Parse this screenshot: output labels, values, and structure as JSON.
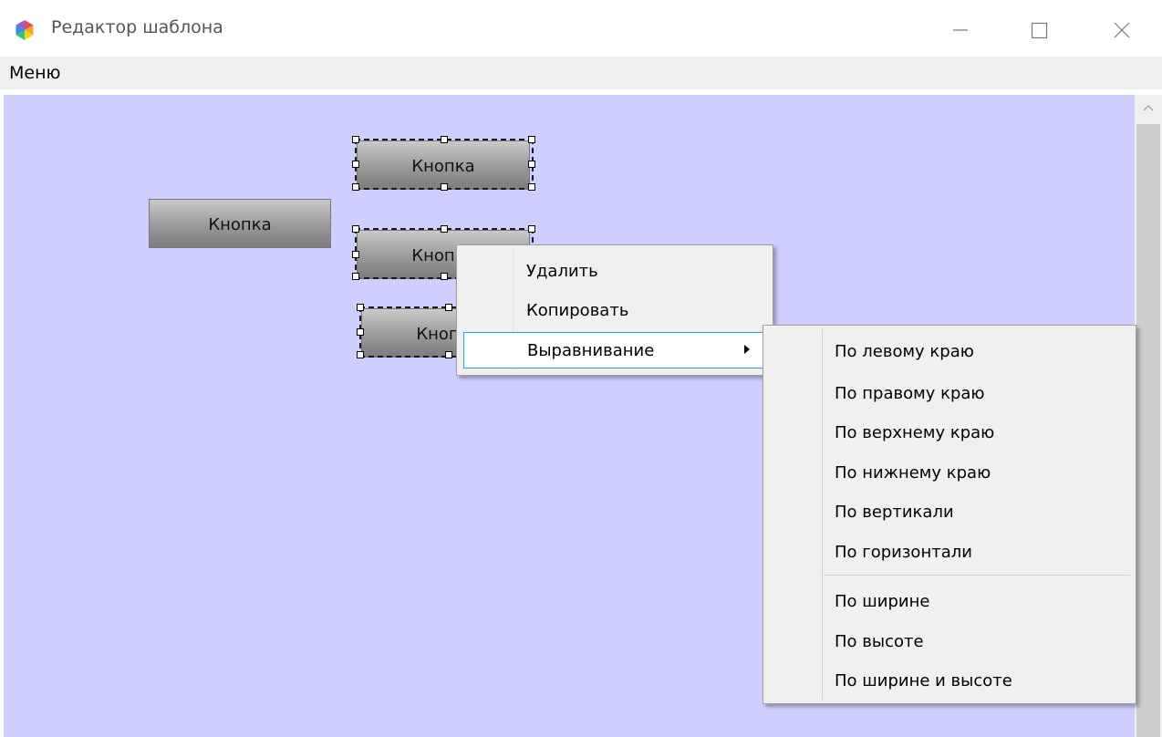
{
  "window": {
    "title": "Редактор шаблона",
    "icon": "app-logo-icon",
    "controls": [
      "minimize-icon",
      "maximize-icon",
      "close-icon"
    ]
  },
  "menubar": {
    "menu_label": "Меню"
  },
  "canvas": {
    "background_color": "#ceceff",
    "buttons": [
      {
        "label": "Кнопка",
        "selected": false
      },
      {
        "label": "Кнопка",
        "selected": true
      },
      {
        "label": "Кнопка",
        "selected": true
      },
      {
        "label": "Кнопка",
        "selected": true
      }
    ]
  },
  "context_menu": {
    "items": [
      {
        "label": "Удалить"
      },
      {
        "label": "Копировать"
      },
      {
        "label": "Выравнивание",
        "has_submenu": true,
        "highlighted": true
      }
    ]
  },
  "align_submenu": {
    "items": [
      "По левому краю",
      "По правому краю",
      "По верхнему краю",
      "По нижнему краю",
      "По вертикали",
      "По горизонтали",
      "По ширине",
      "По высоте",
      "По ширине и высоте"
    ]
  },
  "colors": {
    "highlight_border": "#26a0da",
    "menu_background": "#f0f0f0"
  }
}
